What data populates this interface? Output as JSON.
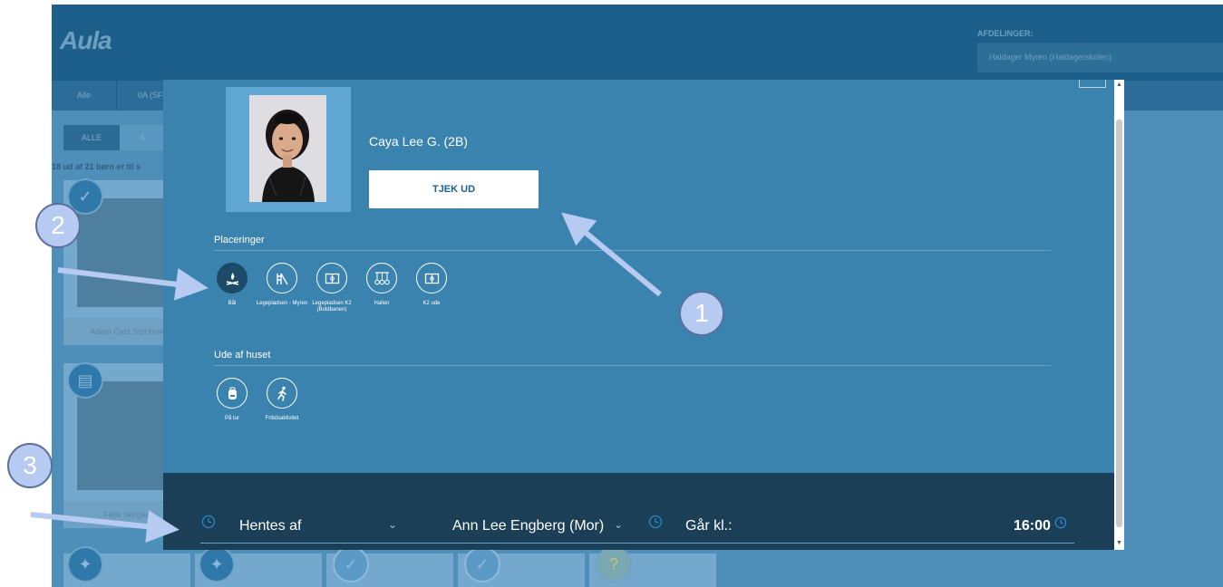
{
  "app": {
    "logo": "Aula",
    "department_label": "AFDELINGER:",
    "department_value": "Haldager Myren (Haldagerskolen)",
    "tabs": [
      "Alle",
      "0A (SF"
    ],
    "filters": {
      "all": "ALLE",
      "a": "A"
    },
    "count_text": "18 ud af 21 børn er til s",
    "children": [
      {
        "name": "Adam Gytz Stechnik"
      },
      {
        "name": "Felix Norgaa"
      }
    ],
    "bottom_status": [
      "✓",
      "✓",
      "?"
    ]
  },
  "modal": {
    "child_name": "Caya Lee G. (2B)",
    "checkout_label": "TJEK UD",
    "placements_title": "Placeringer",
    "placements": [
      {
        "label": "Bål",
        "icon": "bonfire-icon",
        "active": true
      },
      {
        "label": "Legepladsen - Myren",
        "icon": "playground-slide-icon",
        "active": false
      },
      {
        "label": "Legepladsen K2 (Boldbanen)",
        "icon": "football-field-icon",
        "active": false
      },
      {
        "label": "Hallen",
        "icon": "gym-rings-icon",
        "active": false
      },
      {
        "label": "K2 ude",
        "icon": "football-field-icon",
        "active": false
      }
    ],
    "out_title": "Ude af huset",
    "out_options": [
      {
        "label": "På tur",
        "icon": "backpack-icon"
      },
      {
        "label": "Fritidsaktivitet",
        "icon": "running-person-icon"
      }
    ],
    "footer": {
      "pickup_label": "Hentes af",
      "pickup_person": "Ann Lee Engberg (Mor)",
      "leaves_label": "Går kl.:",
      "leaves_time": "16:00"
    }
  },
  "callouts": [
    "1",
    "2",
    "3"
  ],
  "colors": {
    "modal_bg": "#3a83ae",
    "footer_bg": "#1a3f56",
    "active_placement": "#1d4a68",
    "callout": "#b7caf2"
  }
}
